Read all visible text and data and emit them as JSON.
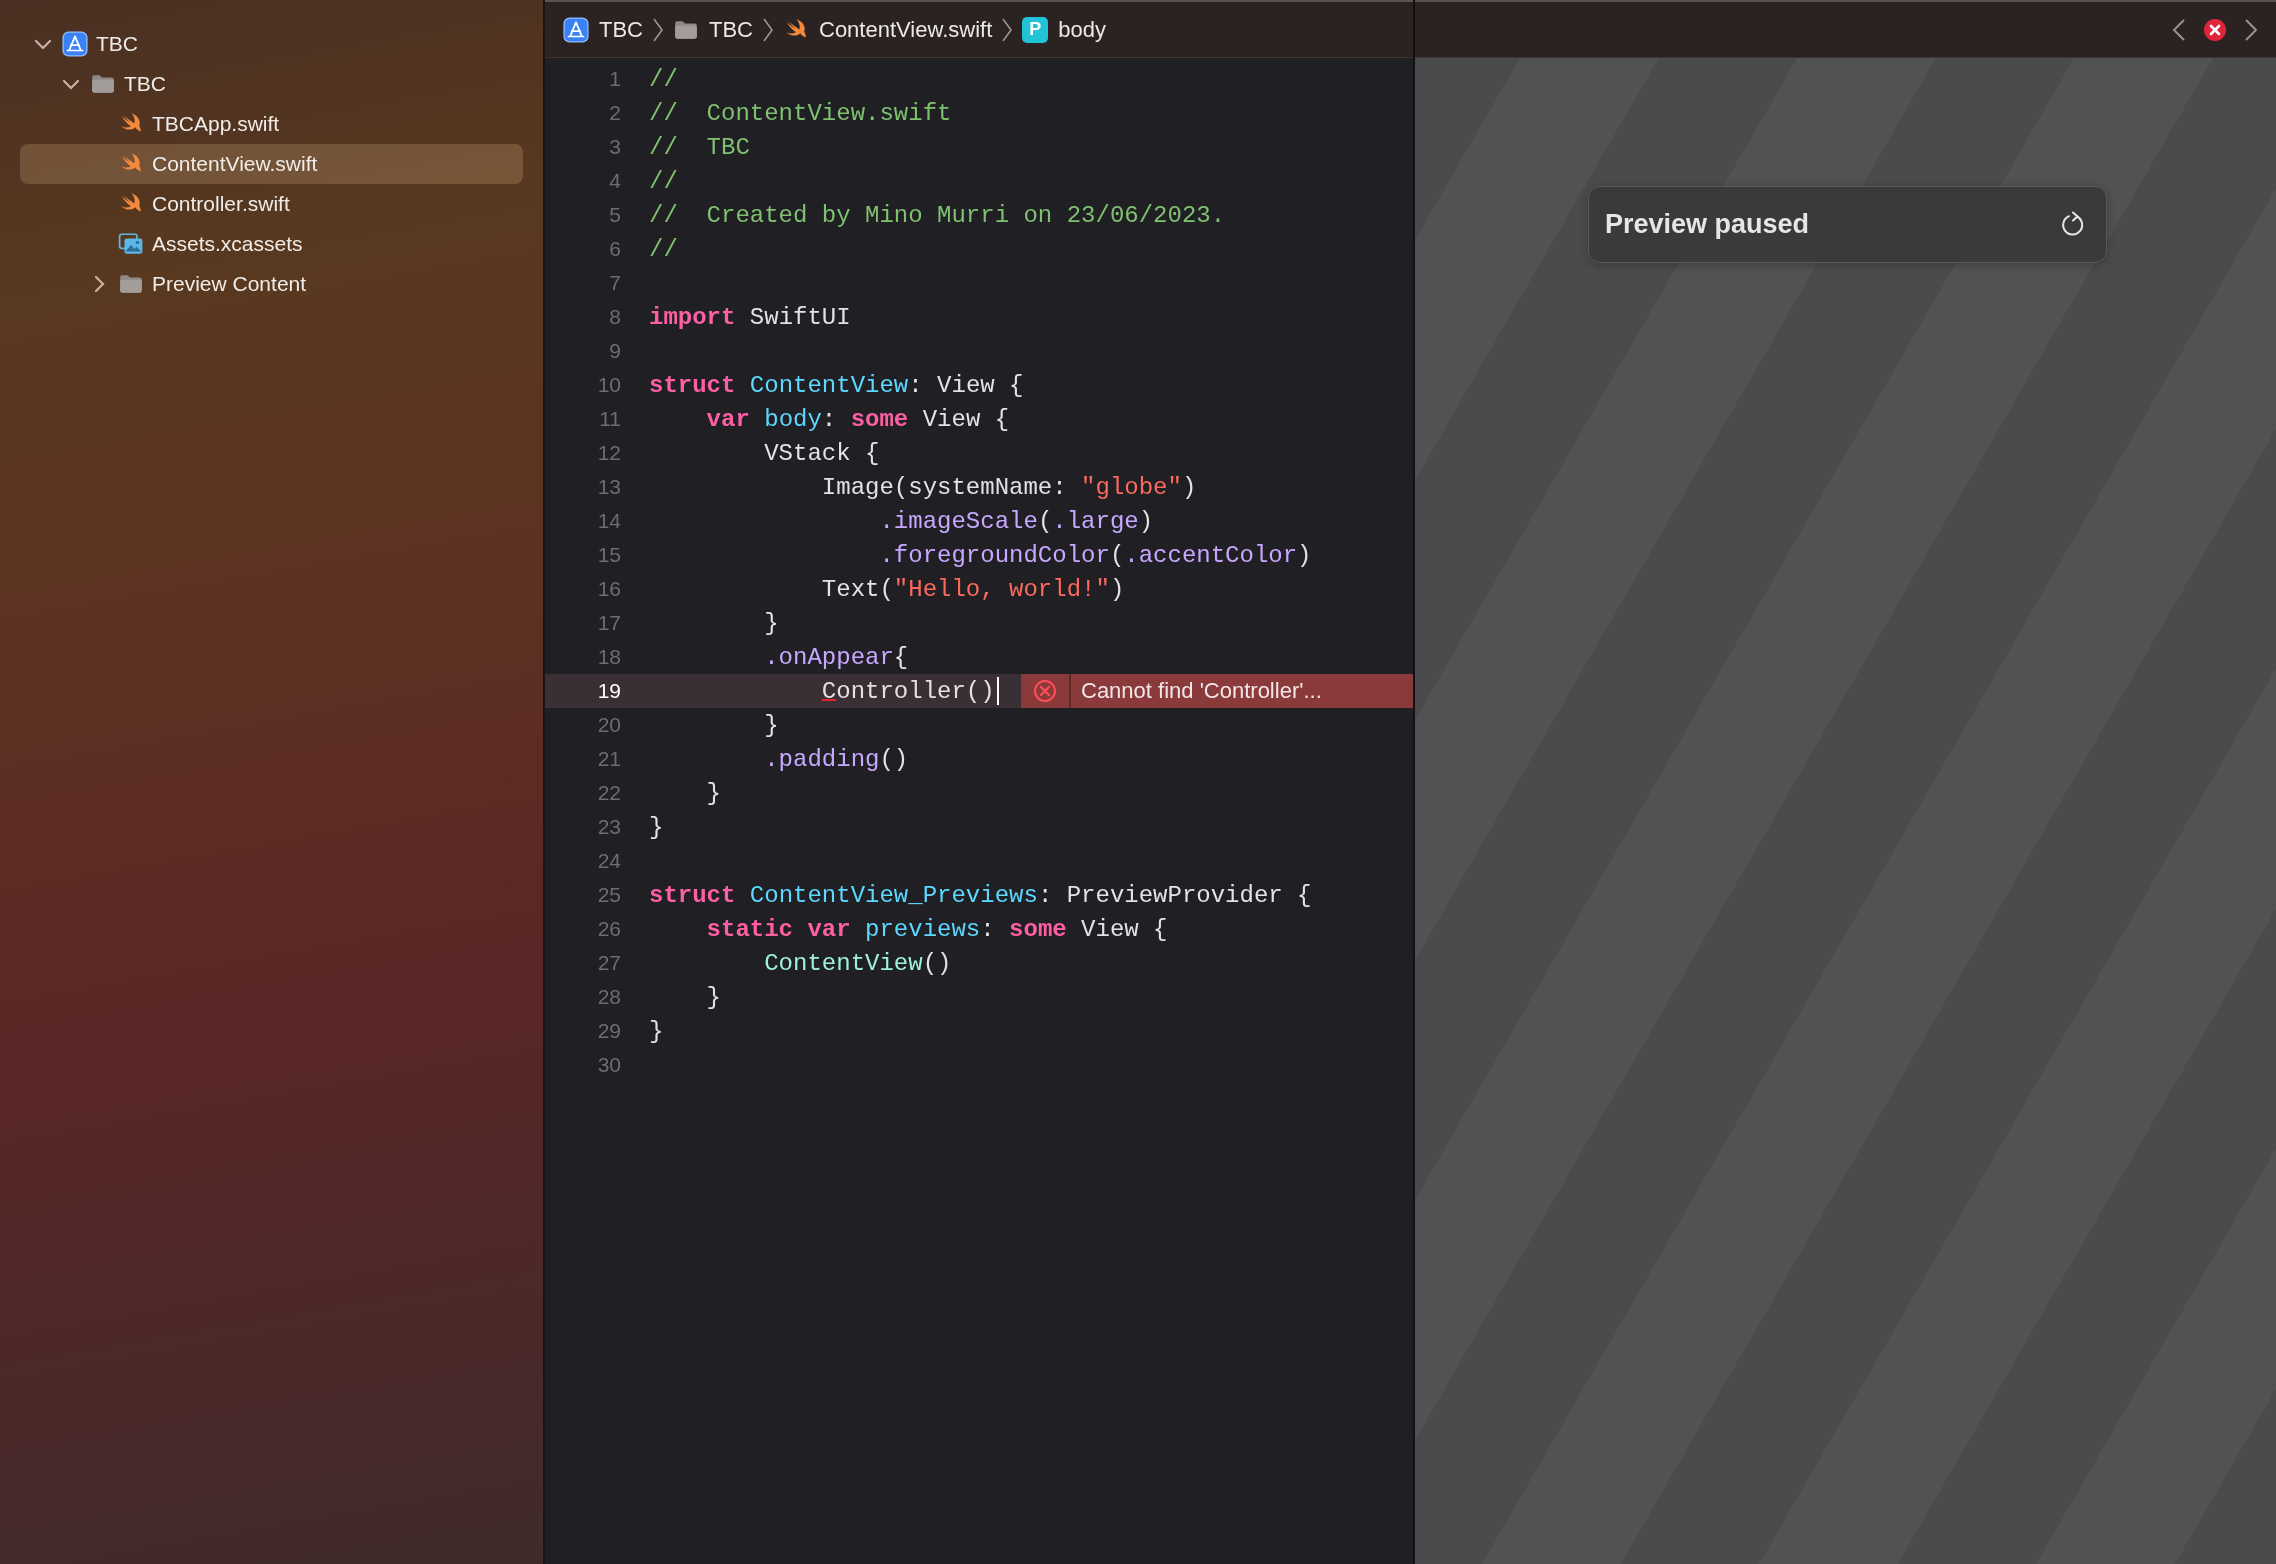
{
  "navigator": {
    "tree": [
      {
        "label": "TBC",
        "kind": "project",
        "expanded": true,
        "selected": false,
        "children": [
          {
            "label": "TBC",
            "kind": "folder",
            "expanded": true,
            "selected": false,
            "children": [
              {
                "label": "TBCApp.swift",
                "kind": "swift",
                "selected": false
              },
              {
                "label": "ContentView.swift",
                "kind": "swift",
                "selected": true
              },
              {
                "label": "Controller.swift",
                "kind": "swift",
                "selected": false
              },
              {
                "label": "Assets.xcassets",
                "kind": "assets",
                "selected": false
              },
              {
                "label": "Preview Content",
                "kind": "folder",
                "expanded": false,
                "selected": false
              }
            ]
          }
        ]
      }
    ]
  },
  "breadcrumb": [
    {
      "label": "TBC",
      "kind": "project"
    },
    {
      "label": "TBC",
      "kind": "folder"
    },
    {
      "label": "ContentView.swift",
      "kind": "swift"
    },
    {
      "label": "body",
      "kind": "symbol",
      "symbol": "P"
    }
  ],
  "editor": {
    "lines": [
      {
        "number": "1",
        "current": false,
        "tokens": [
          {
            "kind": "comment",
            "text": "//"
          }
        ]
      },
      {
        "number": "2",
        "current": false,
        "tokens": [
          {
            "kind": "comment",
            "text": "//  ContentView.swift"
          }
        ]
      },
      {
        "number": "3",
        "current": false,
        "tokens": [
          {
            "kind": "comment",
            "text": "//  TBC"
          }
        ]
      },
      {
        "number": "4",
        "current": false,
        "tokens": [
          {
            "kind": "comment",
            "text": "//"
          }
        ]
      },
      {
        "number": "5",
        "current": false,
        "tokens": [
          {
            "kind": "comment",
            "text": "//  Created by Mino Murri on 23/06/2023."
          }
        ]
      },
      {
        "number": "6",
        "current": false,
        "tokens": [
          {
            "kind": "comment",
            "text": "//"
          }
        ]
      },
      {
        "number": "7",
        "current": false
      },
      {
        "number": "8",
        "current": false,
        "tokens": [
          {
            "kind": "keyword",
            "text": "import"
          },
          {
            "kind": "plain",
            "text": " SwiftUI"
          }
        ]
      },
      {
        "number": "9",
        "current": false
      },
      {
        "number": "10",
        "current": false,
        "tokens": [
          {
            "kind": "keyword",
            "text": "struct"
          },
          {
            "kind": "decl",
            "text": " ContentView"
          },
          {
            "kind": "plain",
            "text": ": View {"
          }
        ]
      },
      {
        "number": "11",
        "current": false,
        "tokens": [
          {
            "kind": "keyword",
            "text": "    var"
          },
          {
            "kind": "decl",
            "text": " body"
          },
          {
            "kind": "plain",
            "text": ":"
          },
          {
            "kind": "keyword",
            "text": " some"
          },
          {
            "kind": "plain",
            "text": " View {"
          }
        ]
      },
      {
        "number": "12",
        "current": false,
        "tokens": [
          {
            "kind": "plain",
            "text": "        VStack {"
          }
        ]
      },
      {
        "number": "13",
        "current": false,
        "tokens": [
          {
            "kind": "plain",
            "text": "            Image(systemName: "
          },
          {
            "kind": "string",
            "text": "\"globe\""
          },
          {
            "kind": "plain",
            "text": ")"
          }
        ]
      },
      {
        "number": "14",
        "current": false,
        "tokens": [
          {
            "kind": "method",
            "text": "                .imageScale"
          },
          {
            "kind": "plain",
            "text": "("
          },
          {
            "kind": "method",
            "text": ".large"
          },
          {
            "kind": "plain",
            "text": ")"
          }
        ]
      },
      {
        "number": "15",
        "current": false,
        "tokens": [
          {
            "kind": "method",
            "text": "                .foregroundColor"
          },
          {
            "kind": "plain",
            "text": "("
          },
          {
            "kind": "method",
            "text": ".accentColor"
          },
          {
            "kind": "plain",
            "text": ")"
          }
        ]
      },
      {
        "number": "16",
        "current": false,
        "tokens": [
          {
            "kind": "plain",
            "text": "            Text("
          },
          {
            "kind": "string",
            "text": "\"Hello, world!\""
          },
          {
            "kind": "plain",
            "text": ")"
          }
        ]
      },
      {
        "number": "17",
        "current": false,
        "tokens": [
          {
            "kind": "plain",
            "text": "        }"
          }
        ]
      },
      {
        "number": "18",
        "current": false,
        "tokens": [
          {
            "kind": "method",
            "text": "        .onAppear"
          },
          {
            "kind": "plain",
            "text": "{"
          }
        ]
      },
      {
        "number": "19",
        "current": true,
        "tokens": [
          {
            "kind": "unresolved",
            "text": "            C"
          },
          {
            "kind": "plain",
            "text": "ontroller()"
          }
        ],
        "diagnostic": {
          "message": "Cannot find 'Controller'..."
        }
      },
      {
        "number": "20",
        "current": false,
        "tokens": [
          {
            "kind": "plain",
            "text": "        }"
          }
        ]
      },
      {
        "number": "21",
        "current": false,
        "tokens": [
          {
            "kind": "method",
            "text": "        .padding"
          },
          {
            "kind": "plain",
            "text": "()"
          }
        ]
      },
      {
        "number": "22",
        "current": false,
        "tokens": [
          {
            "kind": "plain",
            "text": "    }"
          }
        ]
      },
      {
        "number": "23",
        "current": false,
        "tokens": [
          {
            "kind": "plain",
            "text": "}"
          }
        ]
      },
      {
        "number": "24",
        "current": false
      },
      {
        "number": "25",
        "current": false,
        "tokens": [
          {
            "kind": "keyword",
            "text": "struct"
          },
          {
            "kind": "decl",
            "text": " ContentView_Previews"
          },
          {
            "kind": "plain",
            "text": ": PreviewProvider {"
          }
        ]
      },
      {
        "number": "26",
        "current": false,
        "tokens": [
          {
            "kind": "keyword",
            "text": "    static var"
          },
          {
            "kind": "decl",
            "text": " previews"
          },
          {
            "kind": "plain",
            "text": ":"
          },
          {
            "kind": "keyword",
            "text": " some"
          },
          {
            "kind": "plain",
            "text": " View {"
          }
        ]
      },
      {
        "number": "27",
        "current": false,
        "tokens": [
          {
            "kind": "project",
            "text": "        ContentView"
          },
          {
            "kind": "plain",
            "text": "()"
          }
        ]
      },
      {
        "number": "28",
        "current": false,
        "tokens": [
          {
            "kind": "plain",
            "text": "    }"
          }
        ]
      },
      {
        "number": "29",
        "current": false,
        "tokens": [
          {
            "kind": "plain",
            "text": "}"
          }
        ]
      },
      {
        "number": "30",
        "current": false
      }
    ]
  },
  "preview": {
    "message": "Preview paused"
  }
}
